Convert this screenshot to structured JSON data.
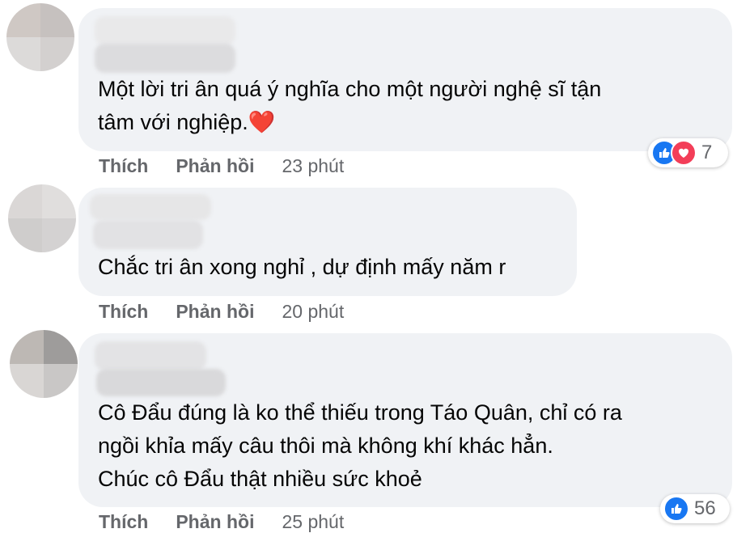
{
  "comments": [
    {
      "text": "Một lời tri ân quá ý nghĩa cho một người nghệ sĩ tận\ntâm với nghiệp.❤️",
      "like_label": "Thích",
      "reply_label": "Phản hồi",
      "time": "23 phút",
      "reactions": {
        "icons": [
          "like-icon",
          "love-icon"
        ],
        "count": "7"
      }
    },
    {
      "text": "Chắc tri ân xong nghỉ , dự định mấy năm r",
      "like_label": "Thích",
      "reply_label": "Phản hồi",
      "time": "20 phút"
    },
    {
      "text": "Cô Đẩu đúng là ko thể thiếu trong Táo Quân, chỉ có ra\nngồi khỉa mấy câu thôi mà không khí khác hẳn.\nChúc cô Đẩu thật nhiều sức khoẻ",
      "like_label": "Thích",
      "reply_label": "Phản hồi",
      "time": "25 phút",
      "reactions": {
        "icons": [
          "like-icon"
        ],
        "count": "56"
      }
    }
  ],
  "colors": {
    "bubble": "#f0f2f5",
    "like_blue": "#1877f2",
    "love_red": "#f33e58",
    "secondary_text": "#65676b"
  }
}
